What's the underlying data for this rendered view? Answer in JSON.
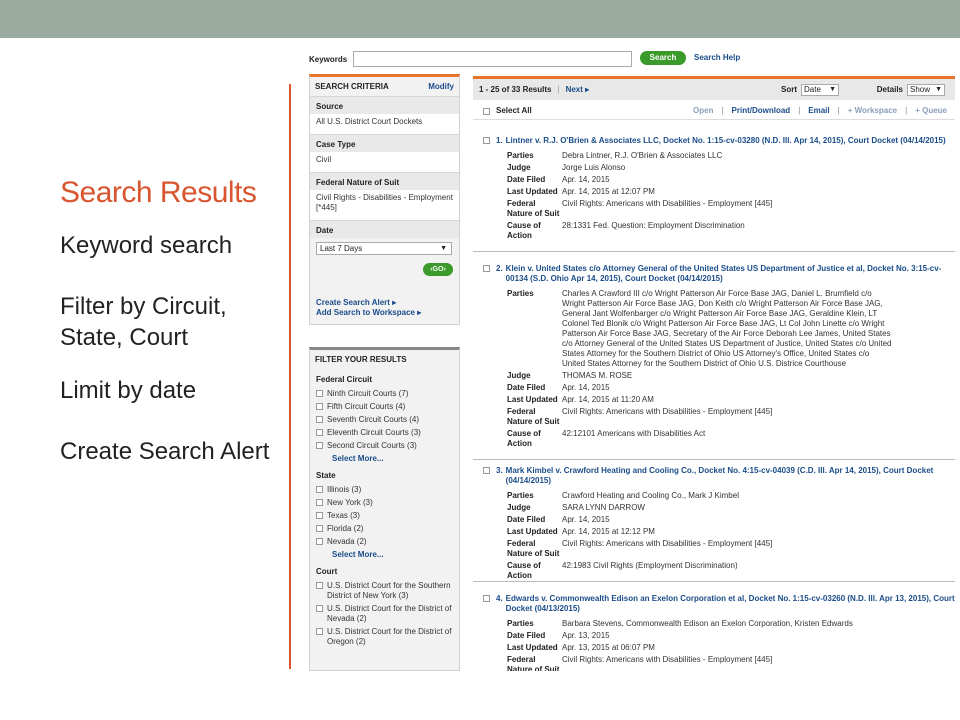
{
  "slide": {
    "title": "Search Results",
    "bullets": [
      "Keyword search",
      "Filter by Circuit, State, Court",
      "Limit by date",
      "Create Search Alert"
    ]
  },
  "search": {
    "keywords_label": "Keywords",
    "keywords_value": "",
    "button": "Search",
    "help": "Search Help"
  },
  "criteria": {
    "heading": "SEARCH CRITERIA",
    "modify": "Modify",
    "source_label": "Source",
    "source_value": "All U.S. District Court Dockets",
    "case_type_label": "Case Type",
    "case_type_value": "Civil",
    "nature_label": "Federal Nature of Suit",
    "nature_value": "Civil Rights - Disabilities - Employment [*445]",
    "date_label": "Date",
    "date_value": "Last 7 Days",
    "go": "GO",
    "create_alert": "Create Search Alert",
    "add_workspace": "Add Search to Workspace"
  },
  "filters": {
    "heading": "FILTER YOUR RESULTS",
    "circuit_label": "Federal Circuit",
    "circuits": [
      "Ninth Circuit Courts (7)",
      "Fifth Circuit Courts (4)",
      "Seventh Circuit Courts (4)",
      "Eleventh Circuit Courts (3)",
      "Second Circuit Courts (3)"
    ],
    "select_more": "Select More...",
    "state_label": "State",
    "states": [
      "Illinois (3)",
      "New York (3)",
      "Texas (3)",
      "Florida (2)",
      "Nevada (2)"
    ],
    "court_label": "Court",
    "courts": [
      "U.S. District Court for the Southern District of New York (3)",
      "U.S. District Court for the District of Nevada (2)",
      "U.S. District Court for the District of Oregon (2)"
    ]
  },
  "results_bar": {
    "count": "1 - 25 of 33 Results",
    "next": "Next",
    "sort_label": "Sort",
    "sort_value": "Date",
    "details_label": "Details",
    "details_value": "Show"
  },
  "actions": {
    "select_all": "Select All",
    "open": "Open",
    "print": "Print/Download",
    "email": "Email",
    "workspace": "+ Workspace",
    "queue": "+ Queue"
  },
  "results": [
    {
      "num": "1.",
      "title": "Lintner v. R.J. O'Brien & Associates LLC, Docket No. 1:15-cv-03280 (N.D. Ill. Apr 14, 2015), Court Docket (04/14/2015)",
      "rows": [
        {
          "k": "Parties",
          "v": "Debra Lintner, R.J. O'Brien & Associates LLC"
        },
        {
          "k": "Judge",
          "v": "Jorge Luis Alonso"
        },
        {
          "k": "Date Filed",
          "v": "Apr. 14, 2015"
        },
        {
          "k": "Last Updated",
          "v": "Apr. 14, 2015 at 12:07 PM"
        },
        {
          "k": "Federal Nature of Suit",
          "v": "Civil Rights: Americans with Disabilities - Employment [445]"
        },
        {
          "k": "Cause of Action",
          "v": "28:1331 Fed. Question: Employment Discrimination"
        }
      ]
    },
    {
      "num": "2.",
      "title": "Klein v. United States c/o Attorney General of the United States US Department of Justice et al, Docket No. 3:15-cv-00134 (S.D. Ohio Apr 14, 2015), Court Docket (04/14/2015)",
      "rows": [
        {
          "k": "Parties",
          "v": "Charles A Crawford III c/o Wright Patterson Air Force Base JAG, Daniel L. Brumfield c/o Wright Patterson Air Force Base JAG, Don Keith c/o Wright Patterson Air Force Base JAG, General Jant Wolfenbarger c/o Wright Patterson Air Force Base JAG, Geraldine Klein, LT Colonel Ted Blonik c/o Wright Patterson Air Force Base JAG, Lt Col John Linette c/o Wright Patterson Air Force Base JAG, Secretary of the Air Force Deborah Lee James, United States c/o Attorney General of the United States US Department of Justice, United States c/o United States Attorney for the Southern District of Ohio US Attorney's Office, United States c/o United States Attorney for the Southern District of Ohio U.S. Districe Courthouse"
        },
        {
          "k": "Judge",
          "v": "THOMAS M. ROSE"
        },
        {
          "k": "Date Filed",
          "v": "Apr. 14, 2015"
        },
        {
          "k": "Last Updated",
          "v": "Apr. 14, 2015 at 11:20 AM"
        },
        {
          "k": "Federal Nature of Suit",
          "v": "Civil Rights: Americans with Disabilities - Employment [445]"
        },
        {
          "k": "Cause of Action",
          "v": "42:12101 Americans with Disabilities Act"
        }
      ]
    },
    {
      "num": "3.",
      "title": "Mark Kimbel v. Crawford Heating and Cooling Co., Docket No. 4:15-cv-04039 (C.D. Ill. Apr 14, 2015), Court Docket (04/14/2015)",
      "rows": [
        {
          "k": "Parties",
          "v": "Crawford Heating and Cooling Co., Mark J Kimbel"
        },
        {
          "k": "Judge",
          "v": "SARA LYNN DARROW"
        },
        {
          "k": "Date Filed",
          "v": "Apr. 14, 2015"
        },
        {
          "k": "Last Updated",
          "v": "Apr. 14, 2015 at 12:12 PM"
        },
        {
          "k": "Federal Nature of Suit",
          "v": "Civil Rights: Americans with Disabilities - Employment [445]"
        },
        {
          "k": "Cause of Action",
          "v": "42:1983 Civil Rights (Employment Discrimination)"
        }
      ]
    },
    {
      "num": "4.",
      "title": "Edwards v. Commonwealth Edison an Exelon Corporation et al, Docket No. 1:15-cv-03260 (N.D. Ill. Apr 13, 2015), Court Docket (04/13/2015)",
      "rows": [
        {
          "k": "Parties",
          "v": "Barbara Stevens, Commonwealth Edison an Exelon Corporation, Kristen Edwards"
        },
        {
          "k": "Date Filed",
          "v": "Apr. 13, 2015"
        },
        {
          "k": "Last Updated",
          "v": "Apr. 13, 2015 at 06:07 PM"
        },
        {
          "k": "Federal Nature of Suit",
          "v": "Civil Rights: Americans with Disabilities - Employment [445]"
        }
      ]
    }
  ]
}
